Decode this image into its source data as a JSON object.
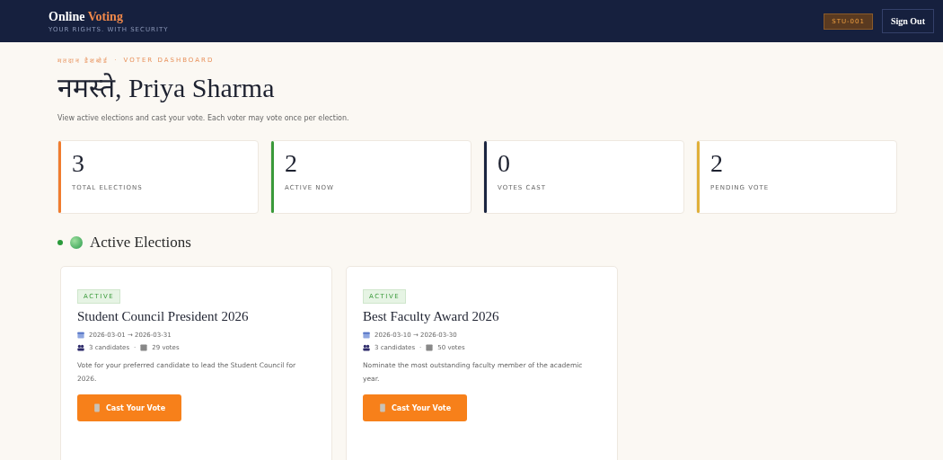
{
  "header": {
    "brand_first": "Online",
    "brand_second": "Voting",
    "tagline": "YOUR RIGHTS. WITH SECURITY",
    "voter_id": "STU-001",
    "sign_out": "Sign Out"
  },
  "kicker": {
    "hindi": "मतदान डैशबोर्ड",
    "separator": "·",
    "english": "VOTER DASHBOARD"
  },
  "greeting": "नमस्ते, Priya Sharma",
  "intro": "View active elections and cast your vote. Each voter may vote once per election.",
  "stats": [
    {
      "value": "3",
      "label": "TOTAL ELECTIONS",
      "color": "#f07c2e"
    },
    {
      "value": "2",
      "label": "ACTIVE NOW",
      "color": "#3a9a3a"
    },
    {
      "value": "0",
      "label": "VOTES CAST",
      "color": "#1b2540"
    },
    {
      "value": "2",
      "label": "PENDING VOTE",
      "color": "#e0b03a"
    }
  ],
  "section_title": "Active Elections",
  "elections": [
    {
      "status": "ACTIVE",
      "title": "Student Council President 2026",
      "dates": "2026-03-01 → 2026-03-31",
      "candidates": "3 candidates",
      "separator": "·",
      "votes": "29 votes",
      "description": "Vote for your preferred candidate to lead the Student Council for 2026.",
      "button": "Cast Your Vote"
    },
    {
      "status": "ACTIVE",
      "title": "Best Faculty Award 2026",
      "dates": "2026-03-10 → 2026-03-30",
      "candidates": "3 candidates",
      "separator": "·",
      "votes": "50 votes",
      "description": "Nominate the most outstanding faculty member of the academic year.",
      "button": "Cast Your Vote"
    }
  ]
}
